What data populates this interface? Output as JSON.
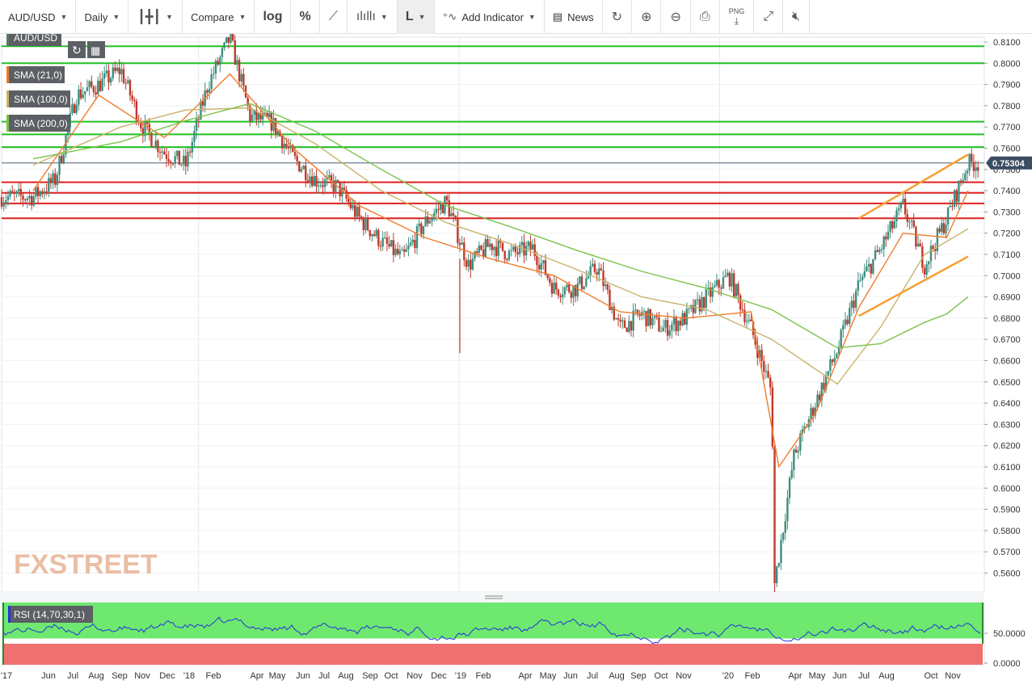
{
  "toolbar": {
    "symbol": "AUD/USD",
    "interval": "Daily",
    "compare": "Compare",
    "log": "log",
    "percent": "%",
    "chart_type": "L",
    "add_indicator": "Add Indicator",
    "news": "News",
    "png": "PNG"
  },
  "legend": {
    "symbol": "AUD/USD",
    "sma21": "SMA (21,0)",
    "sma100": "SMA (100,0)",
    "sma200": "SMA (200,0)",
    "rsi": "RSI (14,70,30,1)"
  },
  "watermark": "FXSTREET",
  "colors": {
    "sma21": "#f07b2b",
    "sma100": "#c8b36a",
    "sma200": "#7cc24a",
    "resistance": "#e01f1f",
    "support_zone": "#22c022",
    "trendline": "#f5a033",
    "candle_up": "#3e8e7e",
    "candle_down": "#c0392b",
    "rsi_line": "#2233dd",
    "rsi_overbought": "#6ee86e",
    "rsi_oversold": "#f07070",
    "price_tag": "#3a4d63"
  },
  "chart_data": {
    "type": "candlestick",
    "title": "",
    "ylim": [
      0.552,
      0.8125
    ],
    "y_ticks": [
      "0.8100",
      "0.8000",
      "0.7900",
      "0.7800",
      "0.7700",
      "0.7600",
      "0.7500",
      "0.7400",
      "0.7300",
      "0.7200",
      "0.7100",
      "0.7000",
      "0.6900",
      "0.6800",
      "0.6700",
      "0.6600",
      "0.6500",
      "0.6400",
      "0.6300",
      "0.6200",
      "0.6100",
      "0.6000",
      "0.5900",
      "0.5800",
      "0.5700",
      "0.5600"
    ],
    "x_ticks": [
      "'17",
      "Jun",
      "Jul",
      "Aug",
      "Sep",
      "Nov",
      "Dec",
      "'18",
      "Feb",
      "Apr",
      "May",
      "Jun",
      "Jul",
      "Aug",
      "Sep",
      "Oct",
      "Nov",
      "Dec",
      "'19",
      "Feb",
      "Apr",
      "May",
      "Jun",
      "Jul",
      "Aug",
      "Sep",
      "Oct",
      "Nov",
      "'20",
      "Feb",
      "Apr",
      "May",
      "Jun",
      "Jul",
      "Aug",
      "Oct",
      "Nov"
    ],
    "last_price": "0.75304",
    "close_path": [
      [
        "2017-05",
        0.737
      ],
      [
        "2017-06",
        0.745
      ],
      [
        "2017-07",
        0.785
      ],
      [
        "2017-08",
        0.79
      ],
      [
        "2017-09",
        0.797
      ],
      [
        "2017-10",
        0.77
      ],
      [
        "2017-11",
        0.758
      ],
      [
        "2017-12",
        0.752
      ],
      [
        "2018-01",
        0.79
      ],
      [
        "2018-02",
        0.812
      ],
      [
        "2018-03",
        0.775
      ],
      [
        "2018-04",
        0.772
      ],
      [
        "2018-05",
        0.755
      ],
      [
        "2018-06",
        0.745
      ],
      [
        "2018-07",
        0.742
      ],
      [
        "2018-08",
        0.727
      ],
      [
        "2018-09",
        0.716
      ],
      [
        "2018-10",
        0.708
      ],
      [
        "2018-11",
        0.725
      ],
      [
        "2018-12",
        0.735
      ],
      [
        "2019-01",
        0.705
      ],
      [
        "2019-02",
        0.715
      ],
      [
        "2019-03",
        0.71
      ],
      [
        "2019-04",
        0.713
      ],
      [
        "2019-05",
        0.694
      ],
      [
        "2019-06",
        0.694
      ],
      [
        "2019-07",
        0.704
      ],
      [
        "2019-08",
        0.675
      ],
      [
        "2019-09",
        0.682
      ],
      [
        "2019-10",
        0.675
      ],
      [
        "2019-11",
        0.68
      ],
      [
        "2019-12",
        0.69
      ],
      [
        "2020-01",
        0.7
      ],
      [
        "2020-02",
        0.675
      ],
      [
        "2020-03",
        0.645
      ],
      [
        "2020-03-19",
        0.555
      ],
      [
        "2020-04",
        0.615
      ],
      [
        "2020-05",
        0.64
      ],
      [
        "2020-06",
        0.665
      ],
      [
        "2020-07",
        0.696
      ],
      [
        "2020-08",
        0.713
      ],
      [
        "2020-09",
        0.733
      ],
      [
        "2020-10",
        0.705
      ],
      [
        "2020-11",
        0.727
      ],
      [
        "2020-12",
        0.753
      ]
    ],
    "sma": [
      {
        "name": "SMA (21,0)",
        "points": [
          [
            "2017-05",
            0.74
          ],
          [
            "2017-08",
            0.785
          ],
          [
            "2017-11",
            0.765
          ],
          [
            "2018-02",
            0.795
          ],
          [
            "2018-05",
            0.76
          ],
          [
            "2018-08",
            0.733
          ],
          [
            "2018-11",
            0.718
          ],
          [
            "2019-02",
            0.708
          ],
          [
            "2019-05",
            0.7
          ],
          [
            "2019-08",
            0.683
          ],
          [
            "2019-11",
            0.68
          ],
          [
            "2020-02",
            0.683
          ],
          [
            "2020-03-25",
            0.61
          ],
          [
            "2020-05",
            0.635
          ],
          [
            "2020-07",
            0.685
          ],
          [
            "2020-09",
            0.72
          ],
          [
            "2020-11",
            0.718
          ],
          [
            "2020-12",
            0.74
          ]
        ]
      },
      {
        "name": "SMA (100,0)",
        "points": [
          [
            "2017-05",
            0.752
          ],
          [
            "2017-09",
            0.77
          ],
          [
            "2017-12",
            0.778
          ],
          [
            "2018-03",
            0.779
          ],
          [
            "2018-06",
            0.762
          ],
          [
            "2018-09",
            0.74
          ],
          [
            "2018-12",
            0.725
          ],
          [
            "2019-03",
            0.715
          ],
          [
            "2019-06",
            0.703
          ],
          [
            "2019-09",
            0.69
          ],
          [
            "2019-12",
            0.684
          ],
          [
            "2020-03",
            0.67
          ],
          [
            "2020-06",
            0.649
          ],
          [
            "2020-08",
            0.676
          ],
          [
            "2020-10",
            0.71
          ],
          [
            "2020-12",
            0.722
          ]
        ]
      },
      {
        "name": "SMA (200,0)",
        "points": [
          [
            "2017-05",
            0.755
          ],
          [
            "2017-09",
            0.763
          ],
          [
            "2017-12",
            0.773
          ],
          [
            "2018-03",
            0.781
          ],
          [
            "2018-06",
            0.768
          ],
          [
            "2018-09",
            0.75
          ],
          [
            "2018-12",
            0.733
          ],
          [
            "2019-03",
            0.723
          ],
          [
            "2019-06",
            0.712
          ],
          [
            "2019-09",
            0.702
          ],
          [
            "2019-12",
            0.694
          ],
          [
            "2020-03",
            0.684
          ],
          [
            "2020-06",
            0.666
          ],
          [
            "2020-08",
            0.668
          ],
          [
            "2020-10",
            0.678
          ],
          [
            "2020-11",
            0.682
          ],
          [
            "2020-12",
            0.69
          ]
        ]
      }
    ],
    "horizontal_levels": {
      "resistance": [
        0.744,
        0.739,
        0.734,
        0.727
      ],
      "support_zone": [
        0.808,
        0.8,
        0.7725,
        0.7665,
        0.7605
      ]
    },
    "trendlines": [
      {
        "from": [
          "2020-07",
          0.727
        ],
        "to": [
          "2020-12",
          0.757
        ]
      },
      {
        "from": [
          "2020-07",
          0.681
        ],
        "to": [
          "2020-12",
          0.709
        ]
      }
    ],
    "rsi": {
      "name": "RSI (14,70,30,1)",
      "ticks": [
        "50.0000",
        "0.0000"
      ],
      "overbought": 70,
      "oversold": 30
    }
  }
}
